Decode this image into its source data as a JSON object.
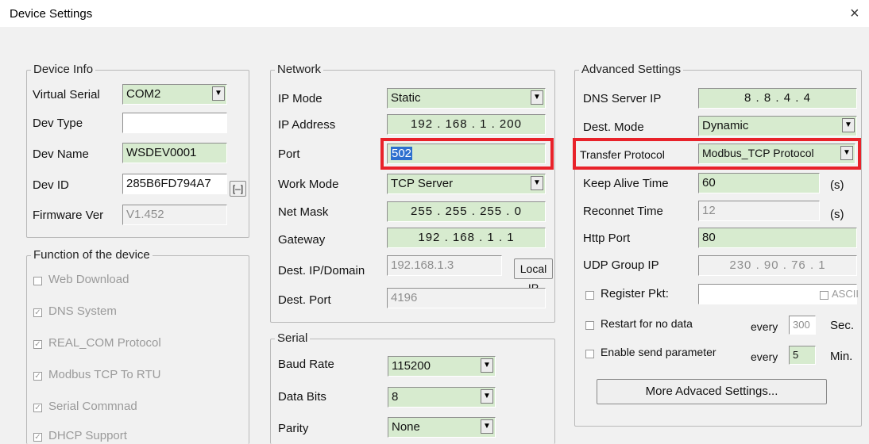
{
  "window": {
    "title": "Device Settings",
    "close": "×"
  },
  "device_info": {
    "title": "Device Info",
    "virtual_serial_label": "Virtual Serial",
    "virtual_serial": "COM2",
    "dev_type_label": "Dev Type",
    "dev_type": "",
    "dev_name_label": "Dev Name",
    "dev_name": "WSDEV0001",
    "dev_id_label": "Dev ID",
    "dev_id": "285B6FD794A7",
    "dev_id_btn": "[–]",
    "firmware_label": "Firmware Ver",
    "firmware": "V1.452"
  },
  "functions": {
    "title": "Function of the device",
    "items": [
      {
        "label": "Web Download",
        "checked": "false"
      },
      {
        "label": "DNS System",
        "checked": "true"
      },
      {
        "label": "REAL_COM Protocol",
        "checked": "true"
      },
      {
        "label": "Modbus TCP To RTU",
        "checked": "true"
      },
      {
        "label": "Serial Commnad",
        "checked": "true"
      },
      {
        "label": "DHCP Support",
        "checked": "true"
      }
    ]
  },
  "network": {
    "title": "Network",
    "ip_mode_label": "IP Mode",
    "ip_mode": "Static",
    "ip_address_label": "IP Address",
    "ip_address": "192 . 168 . 1 . 200",
    "port_label": "Port",
    "port": "502",
    "work_mode_label": "Work Mode",
    "work_mode": "TCP Server",
    "net_mask_label": "Net Mask",
    "net_mask": "255 . 255 . 255 . 0",
    "gateway_label": "Gateway",
    "gateway": "192 . 168 . 1 . 1",
    "dest_ip_label": "Dest. IP/Domain",
    "dest_ip": "192.168.1.3",
    "local_ip_btn": "Local IP",
    "dest_port_label": "Dest. Port",
    "dest_port": "4196"
  },
  "serial": {
    "title": "Serial",
    "baud_label": "Baud Rate",
    "baud": "115200",
    "data_bits_label": "Data Bits",
    "data_bits": "8",
    "parity_label": "Parity",
    "parity": "None"
  },
  "advanced": {
    "title": "Advanced Settings",
    "dns_label": "DNS Server IP",
    "dns": "8 . 8 . 4 . 4",
    "dest_mode_label": "Dest. Mode",
    "dest_mode": "Dynamic",
    "protocol_label": "Transfer Protocol",
    "protocol": "Modbus_TCP Protocol",
    "keepalive_label": "Keep Alive Time",
    "keepalive": "60",
    "keepalive_unit": "(s)",
    "reconnect_label": "Reconnet Time",
    "reconnect": "12",
    "reconnect_unit": "(s)",
    "http_label": "Http Port",
    "http": "80",
    "udp_label": "UDP Group IP",
    "udp": "230 . 90 . 76 . 1",
    "register_label": "Register Pkt:",
    "ascii_label": "ASCII",
    "restart_label": "Restart for no data",
    "restart_every": "every",
    "restart_value": "300",
    "restart_unit": "Sec.",
    "enable_label": "Enable send parameter",
    "enable_every": "every",
    "enable_value": "5",
    "enable_unit": "Min.",
    "more_btn": "More Advaced Settings..."
  },
  "colors": {
    "field_green": "#d7ebcf",
    "highlight_red": "#e8222a",
    "selection_blue": "#2d6fcf"
  },
  "icons": {
    "dropdown": "chevron-down-icon",
    "checkbox_checked": "check-icon",
    "close": "close-icon"
  }
}
